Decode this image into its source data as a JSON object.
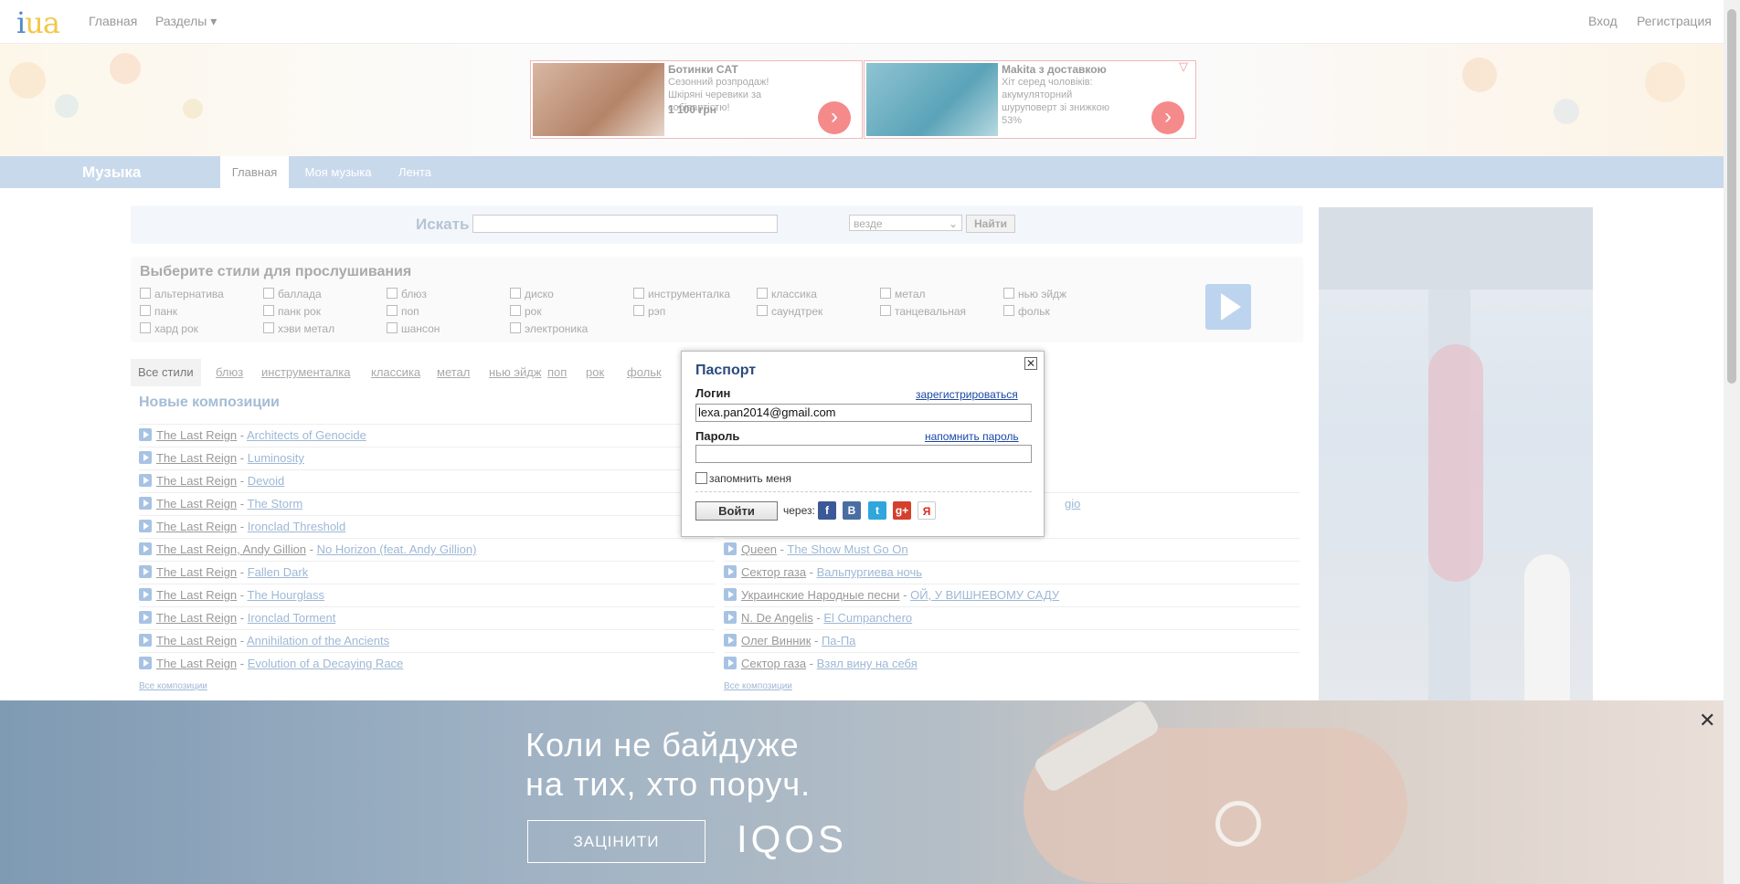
{
  "topnav": {
    "logo_i": "i",
    "logo_ua": "ua",
    "home": "Главная",
    "sections": "Разделы ▾",
    "login": "Вход",
    "register": "Регистрация"
  },
  "ads": [
    {
      "title": "Ботинки CAT",
      "desc": "Сезонний розпродаж! Шкіряні черевики за собівартістю!",
      "price": "1 100 грн"
    },
    {
      "title": "Makita з доставкою",
      "desc": "Хіт серед чоловіків: акумуляторний шуруповерт зі знижкою 53%",
      "price": ""
    }
  ],
  "music": {
    "title": "Музыка",
    "tabs": [
      "Главная",
      "Моя музыка",
      "Лента"
    ]
  },
  "search": {
    "label": "Искать",
    "value": "",
    "scope": "везде",
    "button": "Найти"
  },
  "styles": {
    "heading": "Выберите стили для прослушивания",
    "items": [
      "альтернатива",
      "баллада",
      "блюз",
      "диско",
      "инструменталка",
      "классика",
      "метал",
      "нью эйдж",
      "панк",
      "панк рок",
      "поп",
      "рок",
      "рэп",
      "саундтрек",
      "танцевальная",
      "фольк",
      "хард рок",
      "хэви метал",
      "шансон",
      "электроника"
    ]
  },
  "genre_tabs": [
    "Все стили",
    "блюз",
    "инструменталка",
    "классика",
    "метал",
    "нью эйдж",
    "поп",
    "рок",
    "фольк"
  ],
  "new_heading": "Новые композиции",
  "left_tracks": [
    {
      "artist": "The Last Reign",
      "song": "Architects of Genocide"
    },
    {
      "artist": "The Last Reign",
      "song": "Luminosity"
    },
    {
      "artist": "The Last Reign",
      "song": "Devoid"
    },
    {
      "artist": "The Last Reign",
      "song": "The Storm"
    },
    {
      "artist": "The Last Reign",
      "song": "Ironclad Threshold"
    },
    {
      "artist": "The Last Reign, Andy Gillion",
      "song": "No Horizon (feat. Andy Gillion)"
    },
    {
      "artist": "The Last Reign",
      "song": "Fallen Dark"
    },
    {
      "artist": "The Last Reign",
      "song": "The Hourglass"
    },
    {
      "artist": "The Last Reign",
      "song": "Ironclad Torment"
    },
    {
      "artist": "The Last Reign",
      "song": "Annihilation of the Ancients"
    },
    {
      "artist": "The Last Reign",
      "song": "Evolution of a Decaying Race"
    }
  ],
  "right_tracks_visible_fragment": "gio",
  "right_tracks": [
    {
      "artist": "Queen",
      "song": "The Show Must Go On"
    },
    {
      "artist": "Сектор газа",
      "song": "Вальпургиева ночь"
    },
    {
      "artist": "Украинские Народные песни",
      "song": "ОЙ, У ВИШНЕВОМУ САДУ"
    },
    {
      "artist": "N. De Angelis",
      "song": "El Cumpanchero"
    },
    {
      "artist": "Олег Винник",
      "song": "Па-Па"
    },
    {
      "artist": "Сектор газа",
      "song": "Взял вину на себя"
    }
  ],
  "all_compositions": "Все композиции",
  "modal": {
    "title": "Паспорт",
    "login_label": "Логин",
    "register_link": "зарегистрироваться",
    "login_value": "lexa.pan2014@gmail.com",
    "password_label": "Пароль",
    "remind_link": "напомнить пароль",
    "password_value": "",
    "remember": "запомнить меня",
    "submit": "Войти",
    "via": "через:",
    "social": [
      {
        "icon": "facebook-icon",
        "glyph": "f",
        "color": "#3b5998"
      },
      {
        "icon": "vkontakte-icon",
        "glyph": "B",
        "color": "#4a6ea1"
      },
      {
        "icon": "twitter-icon",
        "glyph": "t",
        "color": "#2fa6dc"
      },
      {
        "icon": "googleplus-icon",
        "glyph": "g+",
        "color": "#d4402d"
      },
      {
        "icon": "yandex-icon",
        "glyph": "Я",
        "color": "#ffffff"
      }
    ]
  },
  "bottom_banner": {
    "line1": "Коли не байдуже",
    "line2": "на тих, хто поруч.",
    "cta": "ЗАЦІНИТИ",
    "brand": "IQOS"
  }
}
